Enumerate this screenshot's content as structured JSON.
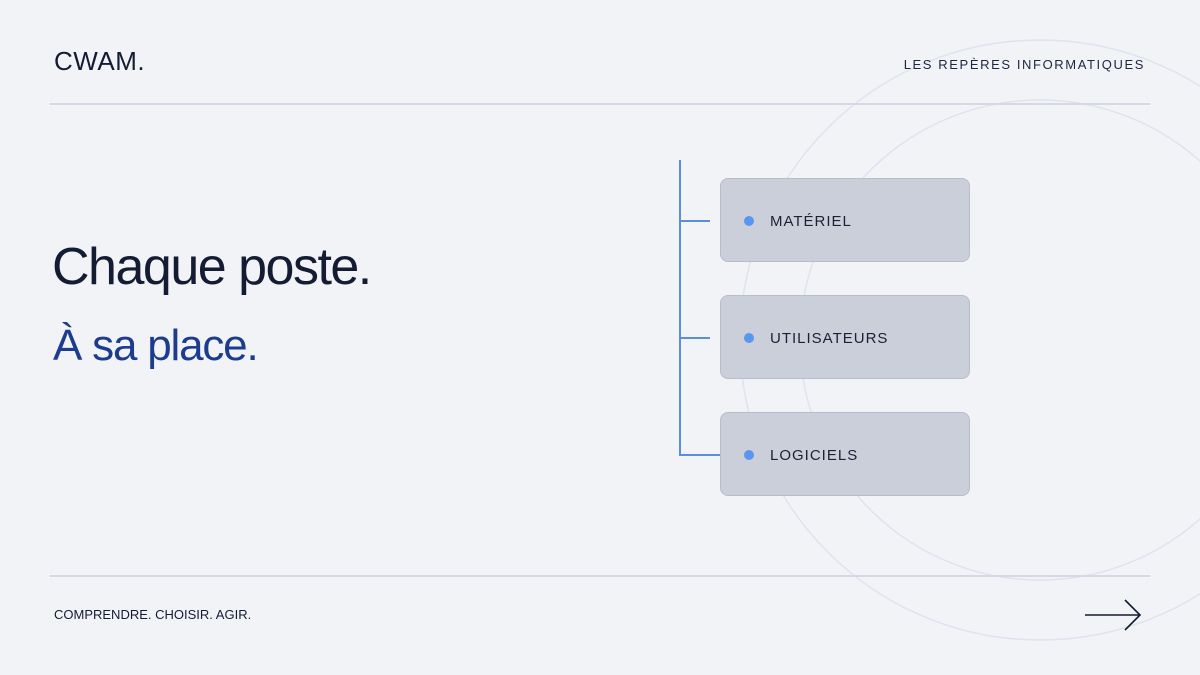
{
  "header": {
    "brand": "CWAM.",
    "tagline": "LES REPÈRES INFORMATIQUES"
  },
  "hero": {
    "headline": "Chaque poste.",
    "subline": "À sa place."
  },
  "tree": {
    "items": [
      {
        "label": "MATÉRIEL"
      },
      {
        "label": "UTILISATEURS"
      },
      {
        "label": "LOGICIELS"
      }
    ]
  },
  "footer": {
    "motto": "COMPRENDRE. CHOISIR. AGIR."
  },
  "colors": {
    "background": "#f2f3f7",
    "ink": "#141c33",
    "accent_blue": "#1d3c8f",
    "tree_line": "#5b8fd9",
    "card": "#cbcfd9",
    "dot": "#5b96ee"
  },
  "icons": {
    "next": "arrow-right-icon"
  }
}
